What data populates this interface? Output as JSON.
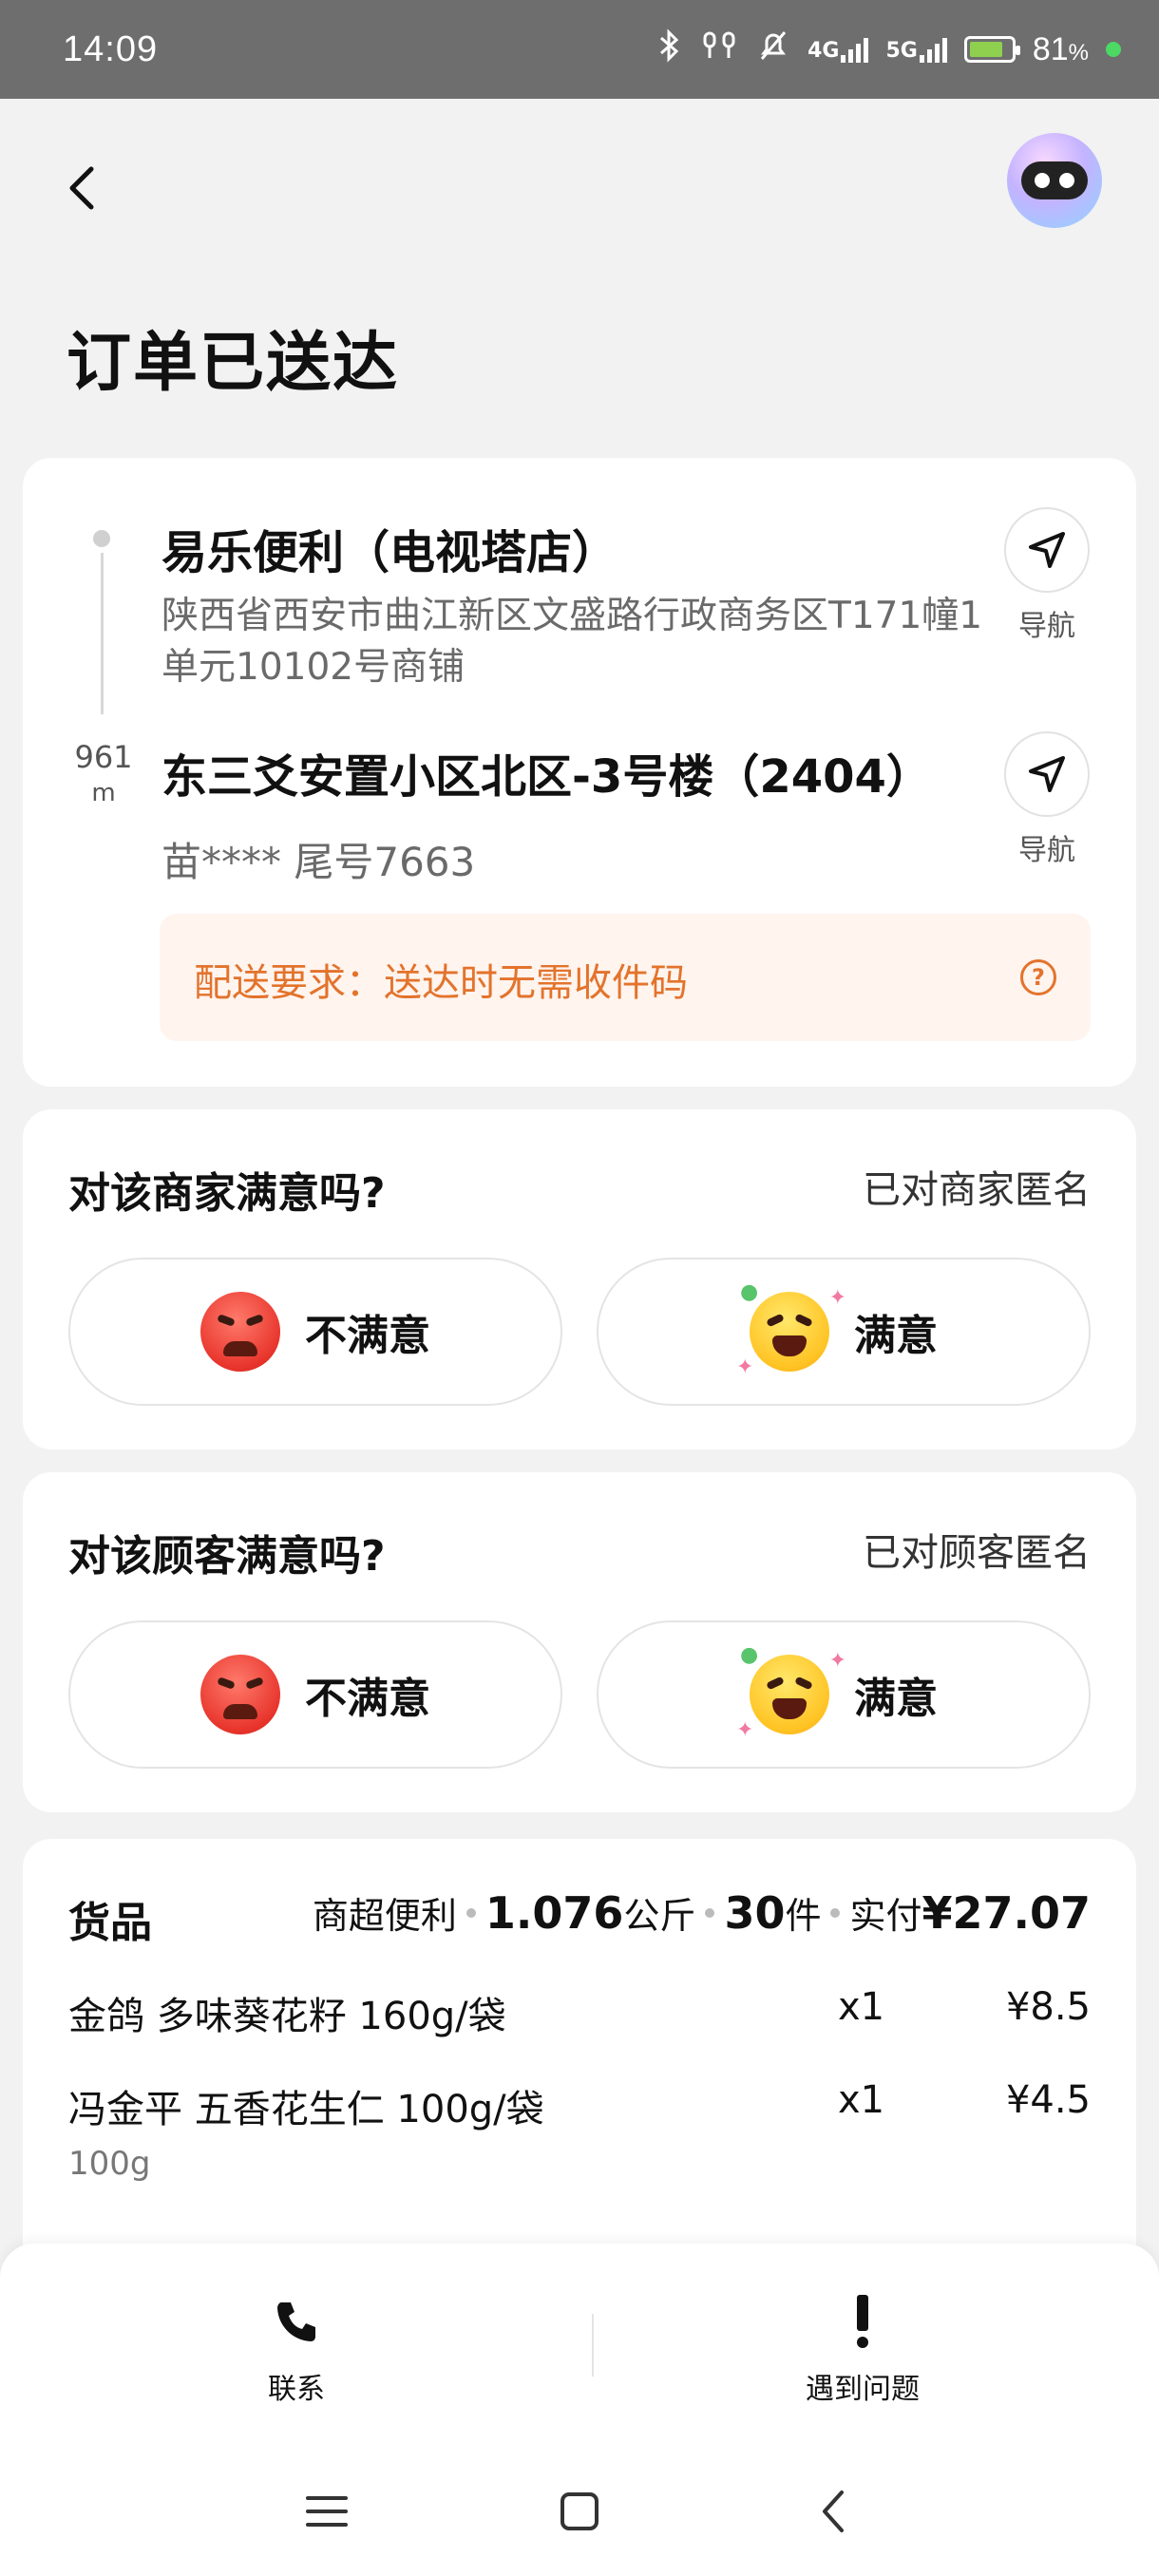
{
  "status_bar": {
    "time": "14:09",
    "network_1": "4G",
    "network_2": "5G",
    "battery_percent": "81",
    "battery_unit": "%"
  },
  "header": {
    "title": "订单已送达"
  },
  "pickup": {
    "name": "易乐便利（电视塔店）",
    "address": "陕西省西安市曲江新区文盛路行政商务区T171幢1单元10102号商铺",
    "nav_label": "导航"
  },
  "distance": {
    "value": "961",
    "unit": "m"
  },
  "delivery": {
    "name": "东三爻安置小区北区-3号楼（2404）",
    "contact": "苗**** 尾号7663",
    "nav_label": "导航"
  },
  "requirement": {
    "text": "配送要求：送达时无需收件码"
  },
  "merchant_rating": {
    "question": "对该商家满意吗?",
    "anon_text": "已对商家匿名",
    "negative_label": "不满意",
    "positive_label": "满意"
  },
  "customer_rating": {
    "question": "对该顾客满意吗?",
    "anon_text": "已对顾客匿名",
    "negative_label": "不满意",
    "positive_label": "满意"
  },
  "goods": {
    "title": "货品",
    "category": "商超便利",
    "weight": "1.076",
    "weight_unit": "公斤",
    "count": "30",
    "count_unit": "件",
    "paid_label": "实付",
    "paid_amount": "¥27.07",
    "items": [
      {
        "name": "金鸽 多味葵花籽 160g/袋",
        "qty": "x1",
        "price": "¥8.5",
        "sub": ""
      },
      {
        "name": "冯金平 五香花生仁 100g/袋",
        "qty": "x1",
        "price": "¥4.5",
        "sub": "100g"
      }
    ]
  },
  "actions": {
    "contact_label": "联系",
    "problem_label": "遇到问题"
  },
  "colors": {
    "accent_orange": "#e3732c",
    "requirement_bg": "#fff4ee",
    "page_bg": "#f2f2f2"
  }
}
